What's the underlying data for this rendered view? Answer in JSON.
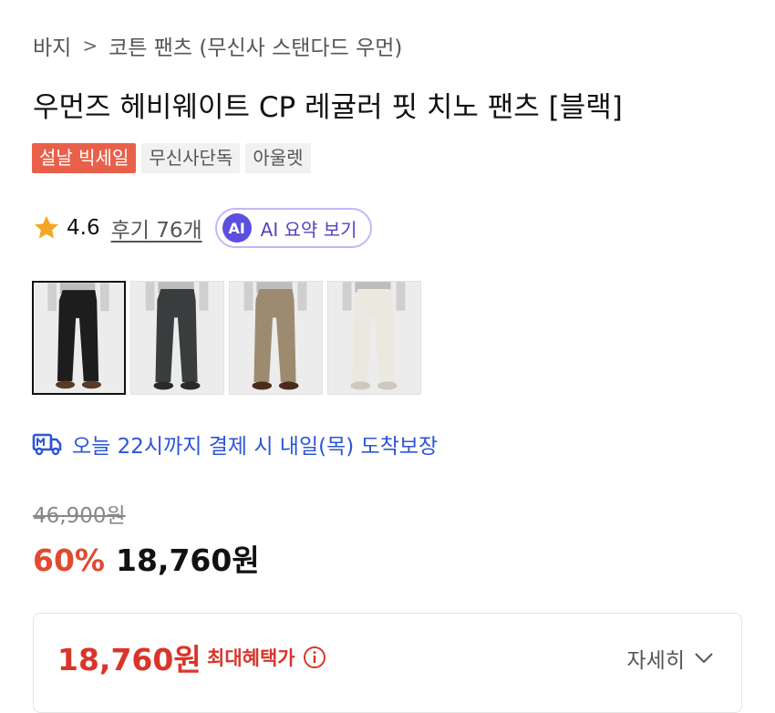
{
  "breadcrumb": {
    "category": "바지",
    "separator": ">",
    "subcategory": "코튼 팬츠 (무신사 스탠다드 우먼)"
  },
  "product": {
    "title": "우먼즈 헤비웨이트 CP 레귤러 핏 치노 팬츠 [블랙]",
    "badges": [
      "설날 빅세일",
      "무신사단독",
      "아울렛"
    ]
  },
  "rating": {
    "score": "4.6",
    "reviews": "후기 76개",
    "ai_icon": "AI",
    "ai_label": "AI 요약 보기"
  },
  "thumbnails": [
    {
      "color_name": "black",
      "pants_color": "#1d1d1d",
      "shoe_color": "#5a3a26",
      "selected": true
    },
    {
      "color_name": "charcoal",
      "pants_color": "#3a3d3d",
      "shoe_color": "#2a2a2a",
      "selected": false
    },
    {
      "color_name": "beige",
      "pants_color": "#9c8b70",
      "shoe_color": "#4a2b1c",
      "selected": false
    },
    {
      "color_name": "ivory",
      "pants_color": "#ebe8df",
      "shoe_color": "#cfc9bd",
      "selected": false
    }
  ],
  "delivery": {
    "text": "오늘 22시까지 결제 시 내일(목) 도착보장",
    "icon": "delivery-truck-icon",
    "color": "#2d55d6"
  },
  "pricing": {
    "original": "46,900원",
    "discount": "60%",
    "sale": "18,760원",
    "accent_color": "#e24a2e"
  },
  "benefit": {
    "price": "18,760원",
    "label": "최대혜택가",
    "details": "자세히"
  }
}
